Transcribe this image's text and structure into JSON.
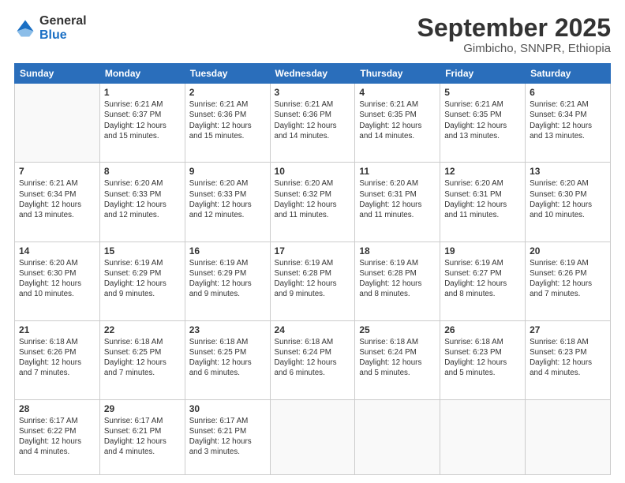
{
  "logo": {
    "general": "General",
    "blue": "Blue"
  },
  "header": {
    "month": "September 2025",
    "location": "Gimbicho, SNNPR, Ethiopia"
  },
  "days_of_week": [
    "Sunday",
    "Monday",
    "Tuesday",
    "Wednesday",
    "Thursday",
    "Friday",
    "Saturday"
  ],
  "weeks": [
    [
      {
        "day": "",
        "info": ""
      },
      {
        "day": "1",
        "info": "Sunrise: 6:21 AM\nSunset: 6:37 PM\nDaylight: 12 hours\nand 15 minutes."
      },
      {
        "day": "2",
        "info": "Sunrise: 6:21 AM\nSunset: 6:36 PM\nDaylight: 12 hours\nand 15 minutes."
      },
      {
        "day": "3",
        "info": "Sunrise: 6:21 AM\nSunset: 6:36 PM\nDaylight: 12 hours\nand 14 minutes."
      },
      {
        "day": "4",
        "info": "Sunrise: 6:21 AM\nSunset: 6:35 PM\nDaylight: 12 hours\nand 14 minutes."
      },
      {
        "day": "5",
        "info": "Sunrise: 6:21 AM\nSunset: 6:35 PM\nDaylight: 12 hours\nand 13 minutes."
      },
      {
        "day": "6",
        "info": "Sunrise: 6:21 AM\nSunset: 6:34 PM\nDaylight: 12 hours\nand 13 minutes."
      }
    ],
    [
      {
        "day": "7",
        "info": "Sunrise: 6:21 AM\nSunset: 6:34 PM\nDaylight: 12 hours\nand 13 minutes."
      },
      {
        "day": "8",
        "info": "Sunrise: 6:20 AM\nSunset: 6:33 PM\nDaylight: 12 hours\nand 12 minutes."
      },
      {
        "day": "9",
        "info": "Sunrise: 6:20 AM\nSunset: 6:33 PM\nDaylight: 12 hours\nand 12 minutes."
      },
      {
        "day": "10",
        "info": "Sunrise: 6:20 AM\nSunset: 6:32 PM\nDaylight: 12 hours\nand 11 minutes."
      },
      {
        "day": "11",
        "info": "Sunrise: 6:20 AM\nSunset: 6:31 PM\nDaylight: 12 hours\nand 11 minutes."
      },
      {
        "day": "12",
        "info": "Sunrise: 6:20 AM\nSunset: 6:31 PM\nDaylight: 12 hours\nand 11 minutes."
      },
      {
        "day": "13",
        "info": "Sunrise: 6:20 AM\nSunset: 6:30 PM\nDaylight: 12 hours\nand 10 minutes."
      }
    ],
    [
      {
        "day": "14",
        "info": "Sunrise: 6:20 AM\nSunset: 6:30 PM\nDaylight: 12 hours\nand 10 minutes."
      },
      {
        "day": "15",
        "info": "Sunrise: 6:19 AM\nSunset: 6:29 PM\nDaylight: 12 hours\nand 9 minutes."
      },
      {
        "day": "16",
        "info": "Sunrise: 6:19 AM\nSunset: 6:29 PM\nDaylight: 12 hours\nand 9 minutes."
      },
      {
        "day": "17",
        "info": "Sunrise: 6:19 AM\nSunset: 6:28 PM\nDaylight: 12 hours\nand 9 minutes."
      },
      {
        "day": "18",
        "info": "Sunrise: 6:19 AM\nSunset: 6:28 PM\nDaylight: 12 hours\nand 8 minutes."
      },
      {
        "day": "19",
        "info": "Sunrise: 6:19 AM\nSunset: 6:27 PM\nDaylight: 12 hours\nand 8 minutes."
      },
      {
        "day": "20",
        "info": "Sunrise: 6:19 AM\nSunset: 6:26 PM\nDaylight: 12 hours\nand 7 minutes."
      }
    ],
    [
      {
        "day": "21",
        "info": "Sunrise: 6:18 AM\nSunset: 6:26 PM\nDaylight: 12 hours\nand 7 minutes."
      },
      {
        "day": "22",
        "info": "Sunrise: 6:18 AM\nSunset: 6:25 PM\nDaylight: 12 hours\nand 7 minutes."
      },
      {
        "day": "23",
        "info": "Sunrise: 6:18 AM\nSunset: 6:25 PM\nDaylight: 12 hours\nand 6 minutes."
      },
      {
        "day": "24",
        "info": "Sunrise: 6:18 AM\nSunset: 6:24 PM\nDaylight: 12 hours\nand 6 minutes."
      },
      {
        "day": "25",
        "info": "Sunrise: 6:18 AM\nSunset: 6:24 PM\nDaylight: 12 hours\nand 5 minutes."
      },
      {
        "day": "26",
        "info": "Sunrise: 6:18 AM\nSunset: 6:23 PM\nDaylight: 12 hours\nand 5 minutes."
      },
      {
        "day": "27",
        "info": "Sunrise: 6:18 AM\nSunset: 6:23 PM\nDaylight: 12 hours\nand 4 minutes."
      }
    ],
    [
      {
        "day": "28",
        "info": "Sunrise: 6:17 AM\nSunset: 6:22 PM\nDaylight: 12 hours\nand 4 minutes."
      },
      {
        "day": "29",
        "info": "Sunrise: 6:17 AM\nSunset: 6:21 PM\nDaylight: 12 hours\nand 4 minutes."
      },
      {
        "day": "30",
        "info": "Sunrise: 6:17 AM\nSunset: 6:21 PM\nDaylight: 12 hours\nand 3 minutes."
      },
      {
        "day": "",
        "info": ""
      },
      {
        "day": "",
        "info": ""
      },
      {
        "day": "",
        "info": ""
      },
      {
        "day": "",
        "info": ""
      }
    ]
  ]
}
